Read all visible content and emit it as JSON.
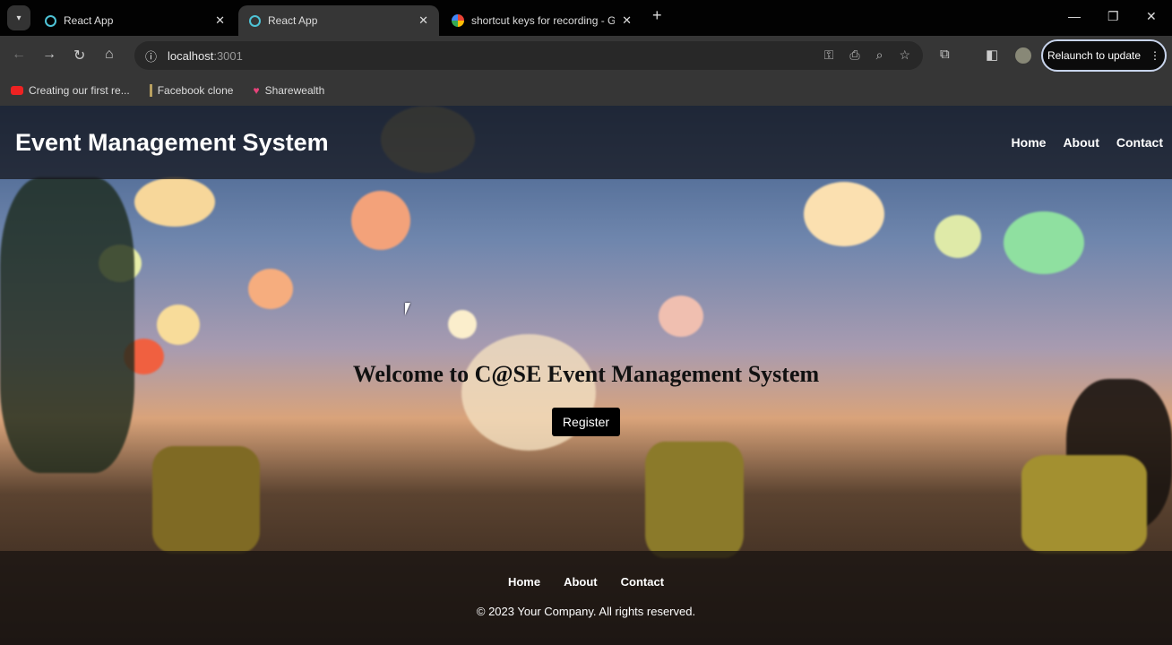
{
  "browser": {
    "tabs": [
      {
        "label": "React App",
        "active": false
      },
      {
        "label": "React App",
        "active": true
      },
      {
        "label": "shortcut keys for recording - G",
        "active": false
      }
    ],
    "url_host": "localhost",
    "url_port": ":3001",
    "relaunch_label": "Relaunch to update",
    "bookmarks": [
      {
        "label": "Creating our first re...",
        "icon": "youtube-icon"
      },
      {
        "label": "Facebook clone",
        "icon": "bookmark-icon"
      },
      {
        "label": "Sharewealth",
        "icon": "heart-icon"
      }
    ]
  },
  "header": {
    "title": "Event Management System",
    "nav": [
      "Home",
      "About",
      "Contact"
    ]
  },
  "hero": {
    "title": "Welcome to C@SE Event Management System",
    "button": "Register"
  },
  "footer": {
    "nav": [
      "Home",
      "About",
      "Contact"
    ],
    "copyright": "© 2023 Your Company. All rights reserved."
  }
}
